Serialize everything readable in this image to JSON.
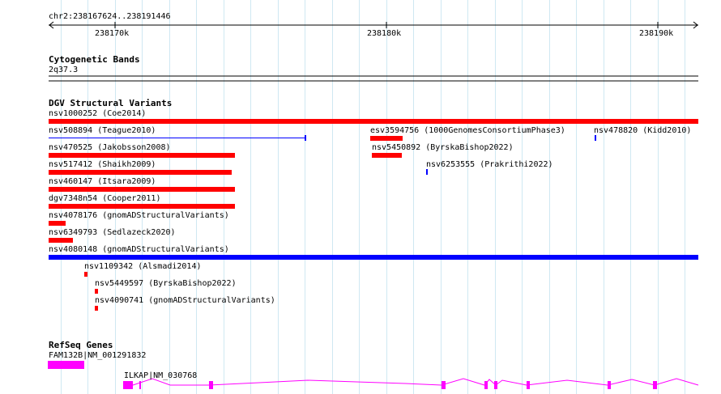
{
  "ruler": {
    "position": "chr2:238167624..238191446",
    "ticks": [
      "238170k",
      "238180k",
      "238190k"
    ]
  },
  "tracks": {
    "cytoband": {
      "title": "Cytogenetic Bands",
      "band": "2q37.3"
    },
    "dgv": {
      "title": "DGV Structural Variants",
      "features": [
        {
          "label": "nsv1000252 (Coe2014)",
          "color": "#ff0000"
        },
        {
          "label": "nsv508894 (Teague2010)",
          "color": "#0000ff"
        },
        {
          "label": "esv3594756 (1000GenomesConsortiumPhase3)",
          "color": "#ff0000"
        },
        {
          "label": "nsv478820 (Kidd2010)",
          "color": "#0000ff"
        },
        {
          "label": "nsv470525 (Jakobsson2008)",
          "color": "#ff0000"
        },
        {
          "label": "nsv5450892 (ByrskaBishop2022)",
          "color": "#ff0000"
        },
        {
          "label": "nsv517412 (Shaikh2009)",
          "color": "#ff0000"
        },
        {
          "label": "nsv6253555 (Prakrithi2022)",
          "color": "#0000ff"
        },
        {
          "label": "nsv460147 (Itsara2009)",
          "color": "#ff0000"
        },
        {
          "label": "dgv7348n54 (Cooper2011)",
          "color": "#ff0000"
        },
        {
          "label": "nsv4078176 (gnomADStructuralVariants)",
          "color": "#ff0000"
        },
        {
          "label": "nsv6349793 (Sedlazeck2020)",
          "color": "#ff0000"
        },
        {
          "label": "nsv4080148 (gnomADStructuralVariants)",
          "color": "#0000ff"
        },
        {
          "label": "nsv1109342 (Alsmadi2014)",
          "color": "#ff0000"
        },
        {
          "label": "nsv5449597 (ByrskaBishop2022)",
          "color": "#ff0000"
        },
        {
          "label": "nsv4090741 (gnomADStructuralVariants)",
          "color": "#ff0000"
        }
      ]
    },
    "refseq": {
      "title": "RefSeq Genes",
      "genes": [
        {
          "label": "FAM132B|NM_001291832",
          "color": "#ff00ff"
        },
        {
          "label": "ILKAP|NM_030768",
          "color": "#ff00ff"
        }
      ]
    }
  }
}
